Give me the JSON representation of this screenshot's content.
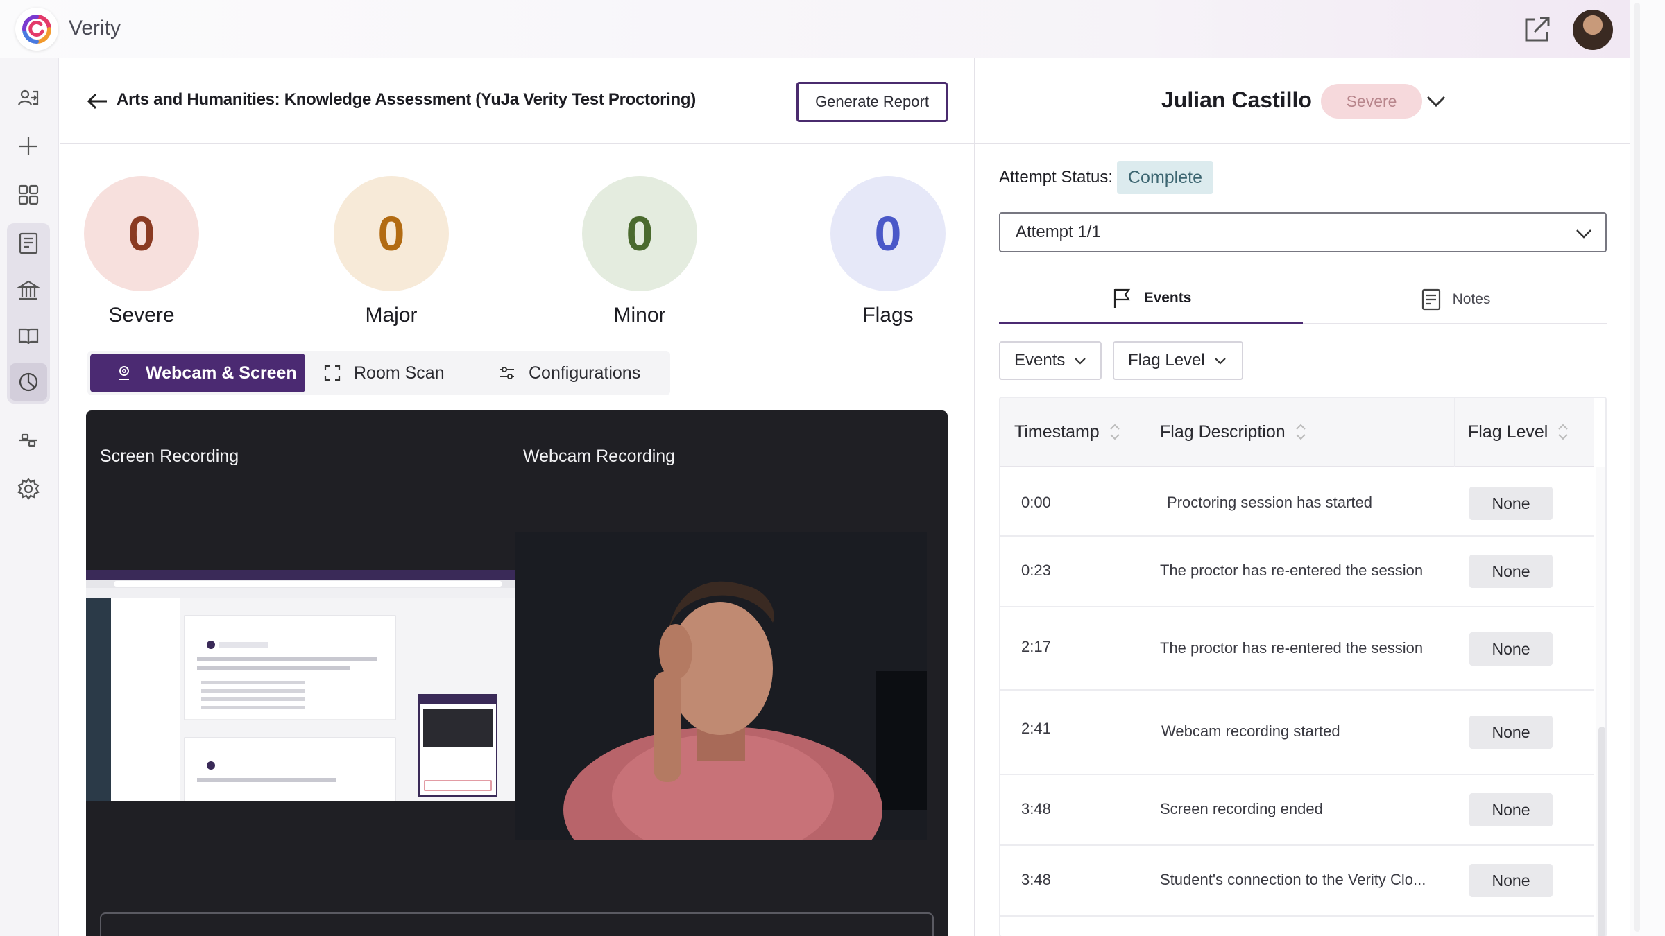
{
  "app": {
    "name": "Verity"
  },
  "header": {
    "title": "Arts and Humanities: Knowledge Assessment (YuJa Verity Test Proctoring)",
    "generate_report_label": "Generate Report"
  },
  "stats": [
    {
      "label": "Severe",
      "value": "0",
      "bg": "#f7e0dd",
      "fg": "#8a3a22"
    },
    {
      "label": "Major",
      "value": "0",
      "bg": "#f7ead8",
      "fg": "#b26b12"
    },
    {
      "label": "Minor",
      "value": "0",
      "bg": "#e4ecdf",
      "fg": "#4a6a2e"
    },
    {
      "label": "Flags",
      "value": "0",
      "bg": "#e6e8f8",
      "fg": "#4a58c8"
    }
  ],
  "tabs": {
    "webcam_screen": "Webcam & Screen",
    "room_scan": "Room Scan",
    "configurations": "Configurations"
  },
  "player": {
    "screen_label": "Screen Recording",
    "webcam_label": "Webcam Recording"
  },
  "student": {
    "name": "Julian Castillo",
    "severity": "Severe"
  },
  "attempt": {
    "status_label": "Attempt Status:",
    "status": "Complete",
    "selected": "Attempt 1/1"
  },
  "panel_tabs": {
    "events": "Events",
    "notes": "Notes"
  },
  "filters": {
    "events": "Events",
    "flag_level": "Flag Level"
  },
  "table": {
    "headers": {
      "timestamp": "Timestamp",
      "description": "Flag Description",
      "level": "Flag Level"
    },
    "rows": [
      {
        "time": "0:00",
        "desc": "Proctoring session has started",
        "level": "None"
      },
      {
        "time": "0:23",
        "desc": "The proctor has re-entered the session",
        "level": "None"
      },
      {
        "time": "2:17",
        "desc": "The proctor has re-entered the session",
        "level": "None"
      },
      {
        "time": "2:41",
        "desc": "Webcam recording started",
        "level": "None"
      },
      {
        "time": "3:48",
        "desc": "Screen recording ended",
        "level": "None"
      },
      {
        "time": "3:48",
        "desc": "Student's connection to the Verity Clo...",
        "level": "None"
      }
    ]
  },
  "colors": {
    "accent": "#4b2a72",
    "severe_pill_bg": "#f6d9dc",
    "status_bg": "#dcebee"
  },
  "icons": {
    "rail": [
      "sign-in-icon",
      "plus-icon",
      "grid-icon",
      "report-icon",
      "institution-icon",
      "book-icon",
      "analytics-icon",
      "integration-icon",
      "settings-icon"
    ],
    "top": [
      "external-link-icon"
    ]
  }
}
